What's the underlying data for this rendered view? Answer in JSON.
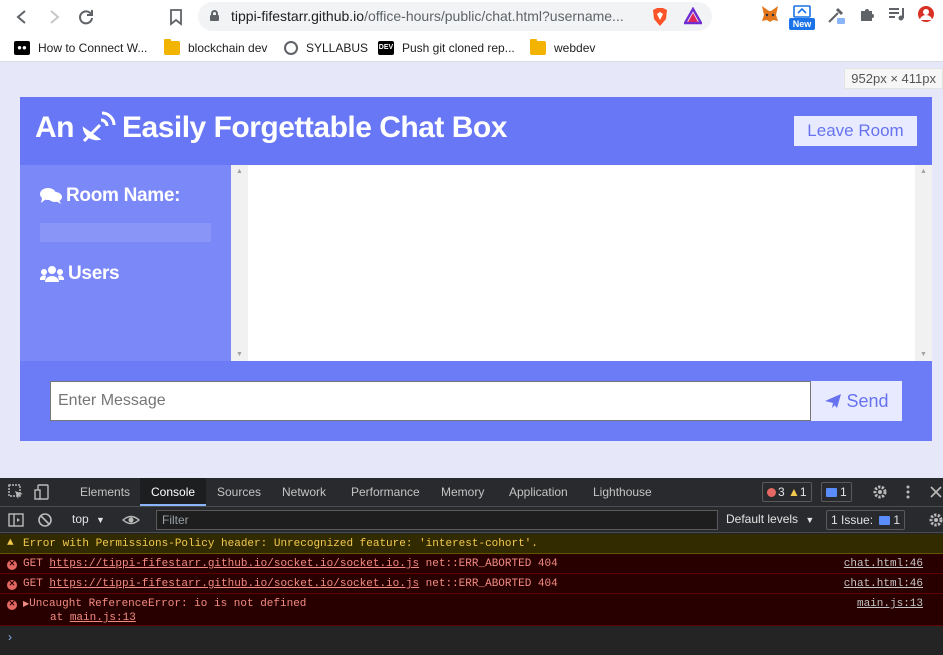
{
  "browser": {
    "url_host": "tippi-fifestarr.github.io",
    "url_path": "/office-hours/public/chat.html?username...",
    "extension_badge": "New",
    "bookmarks": [
      {
        "label": "How to Connect W...",
        "icon": "medium-icon"
      },
      {
        "label": "blockchain dev",
        "icon": "folder-icon"
      },
      {
        "label": "SYLLABUS",
        "icon": "globe-icon"
      },
      {
        "label": "Push git cloned rep...",
        "icon": "dev-icon"
      },
      {
        "label": "webdev",
        "icon": "folder-icon"
      }
    ]
  },
  "viewport_dimensions": "952px × 411px",
  "chat": {
    "title_before": "An",
    "title_after": "Easily Forgettable Chat Box",
    "leave_button": "Leave Room",
    "room_name_label": "Room Name:",
    "users_label": "Users",
    "message_placeholder": "Enter Message",
    "send_button": "Send"
  },
  "devtools": {
    "tabs": [
      "Elements",
      "Console",
      "Sources",
      "Network",
      "Performance",
      "Memory",
      "Application",
      "Lighthouse"
    ],
    "active_tab": "Console",
    "error_count": "3",
    "warning_count": "1",
    "message_count": "1",
    "context": "top",
    "filter_placeholder": "Filter",
    "levels": "Default levels",
    "issues_label": "1 Issue:",
    "issues_count": "1",
    "logs": [
      {
        "level": "warning",
        "text": "Error with Permissions-Policy header: Unrecognized feature: 'interest-cohort'.",
        "source": ""
      },
      {
        "level": "error",
        "prefix": "GET ",
        "link": "https://tippi-fifestarr.github.io/socket.io/socket.io.js",
        "suffix": " net::ERR_ABORTED 404",
        "source": "chat.html:46"
      },
      {
        "level": "error",
        "prefix": "GET ",
        "link": "https://tippi-fifestarr.github.io/socket.io/socket.io.js",
        "suffix": " net::ERR_ABORTED 404",
        "source": "chat.html:46"
      },
      {
        "level": "error",
        "text": "Uncaught ReferenceError: io is not defined",
        "detail_prefix": "at ",
        "detail_link": "main.js:13",
        "source": "main.js:13"
      }
    ]
  }
}
